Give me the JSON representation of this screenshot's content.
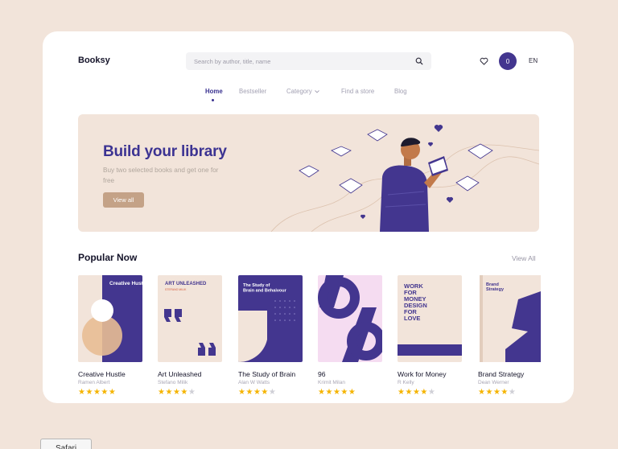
{
  "header": {
    "logo": "Booksy",
    "search_placeholder": "Search by author, title, name",
    "cart_count": "0",
    "language": "EN"
  },
  "nav": {
    "items": [
      {
        "label": "Home",
        "active": true
      },
      {
        "label": "Bestseller",
        "active": false
      },
      {
        "label": "Category",
        "active": false,
        "dropdown": true
      },
      {
        "label": "Find a store",
        "active": false
      },
      {
        "label": "Blog",
        "active": false
      }
    ]
  },
  "hero": {
    "title": "Build your library",
    "subtitle": "Buy two selected books and get one for free",
    "button_label": "View all"
  },
  "popular": {
    "title": "Popular Now",
    "view_all": "View All",
    "books": [
      {
        "title": "Creative Hustle",
        "author": "Ramen Albert",
        "rating": 5,
        "cover_text": "Creative Hustle"
      },
      {
        "title": "Art Unleashed",
        "author": "Stefano Milik",
        "rating": 4,
        "cover_text": "ART UNLEASHED",
        "cover_sub": "STEFANO MILIK"
      },
      {
        "title": "The Study of Brain",
        "author": "Alan W Watts",
        "rating": 4,
        "cover_text": "The Study of Brain and Behaivour"
      },
      {
        "title": "96",
        "author": "Krimit Milan",
        "rating": 5,
        "cover_text": ""
      },
      {
        "title": "Work for Money",
        "author": "R Kelly",
        "rating": 4,
        "cover_text": "WORK FOR MONEY DESIGN FOR LOVE"
      },
      {
        "title": "Brand Strategy",
        "author": "Dean Werner",
        "rating": 4,
        "cover_text": "Brand Strategy"
      }
    ]
  },
  "browser": {
    "tab_label": "Safari"
  },
  "colors": {
    "brand": "#43368f",
    "hero_bg": "#f2e4da",
    "accent_tan": "#c4a287",
    "star": "#f5b400"
  }
}
